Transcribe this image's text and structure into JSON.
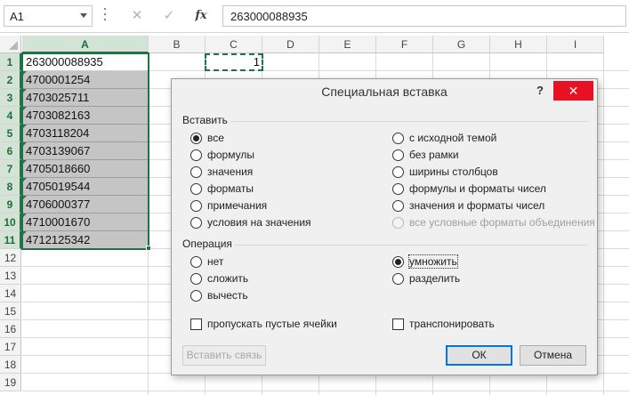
{
  "formula_bar": {
    "name_box": "A1",
    "cancel_glyph": "✕",
    "enter_glyph": "✓",
    "fx_label": "fx",
    "value": "263000088935"
  },
  "grid": {
    "columns": [
      "A",
      "B",
      "C",
      "D",
      "E",
      "F",
      "G",
      "H",
      "I"
    ],
    "rows": [
      "1",
      "2",
      "3",
      "4",
      "5",
      "6",
      "7",
      "8",
      "9",
      "10",
      "11",
      "12",
      "13",
      "14",
      "15",
      "16",
      "17",
      "18",
      "19"
    ],
    "column_a": [
      "263000088935",
      "4700001254",
      "4703025711",
      "4703082163",
      "4703118204",
      "4703139067",
      "4705018660",
      "4705019544",
      "4706000377",
      "4710001670",
      "4712125342"
    ],
    "c1": "1",
    "selected_column": "A",
    "accent": "#217346"
  },
  "dialog": {
    "title": "Специальная вставка",
    "help": "?",
    "close": "✕",
    "paste_group": "Вставить",
    "paste_left": [
      "все",
      "формулы",
      "значения",
      "форматы",
      "примечания",
      "условия на значения"
    ],
    "paste_right": [
      "с исходной темой",
      "без рамки",
      "ширины столбцов",
      "формулы и форматы чисел",
      "значения и форматы чисел",
      "все условные форматы объединения"
    ],
    "paste_selected": "все",
    "operation_group": "Операция",
    "operation_left": [
      "нет",
      "сложить",
      "вычесть"
    ],
    "operation_right": [
      "умножить",
      "разделить"
    ],
    "operation_selected": "умножить",
    "skip_blanks": "пропускать пустые ячейки",
    "transpose": "транспонировать",
    "paste_link_button": "Вставить связь",
    "ok_button": "ОК",
    "cancel_button": "Отмена"
  }
}
